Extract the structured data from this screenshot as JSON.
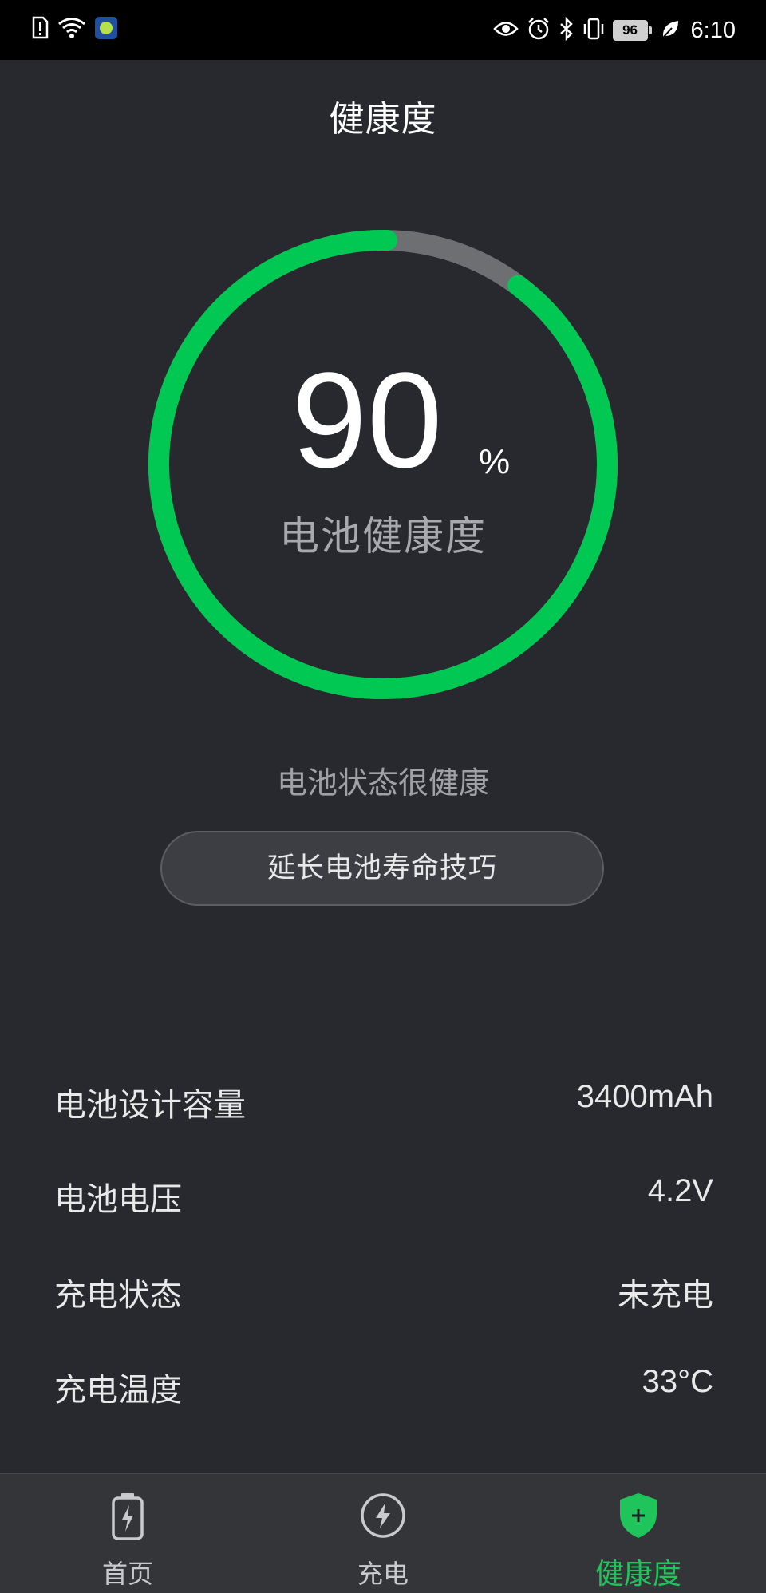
{
  "status_bar": {
    "time": "6:10",
    "battery_level": "96",
    "left_icons": [
      "sim-alert-icon",
      "wifi-icon",
      "app-notification-icon"
    ],
    "right_icons": [
      "eye-icon",
      "alarm-icon",
      "bluetooth-icon",
      "vibrate-icon",
      "battery-icon",
      "leaf-icon"
    ]
  },
  "header": {
    "title": "健康度"
  },
  "health_ring": {
    "value": "90",
    "unit": "%",
    "caption": "电池健康度",
    "percent": 90,
    "accent_color": "#00c853",
    "track_color": "#6e6f73"
  },
  "status": {
    "text": "电池状态很健康"
  },
  "tips_button": {
    "label": "延长电池寿命技巧"
  },
  "info": [
    {
      "label": "电池设计容量",
      "value": "3400mAh"
    },
    {
      "label": "电池电压",
      "value": "4.2V"
    },
    {
      "label": "充电状态",
      "value": "未充电"
    },
    {
      "label": "充电温度",
      "value": "33°C"
    }
  ],
  "bottom_nav": {
    "items": [
      {
        "label": "首页",
        "icon": "battery-icon",
        "active": false
      },
      {
        "label": "充电",
        "icon": "charge-bolt-icon",
        "active": false
      },
      {
        "label": "健康度",
        "icon": "shield-plus-icon",
        "active": true
      }
    ],
    "active_color": "#1fc55b"
  }
}
